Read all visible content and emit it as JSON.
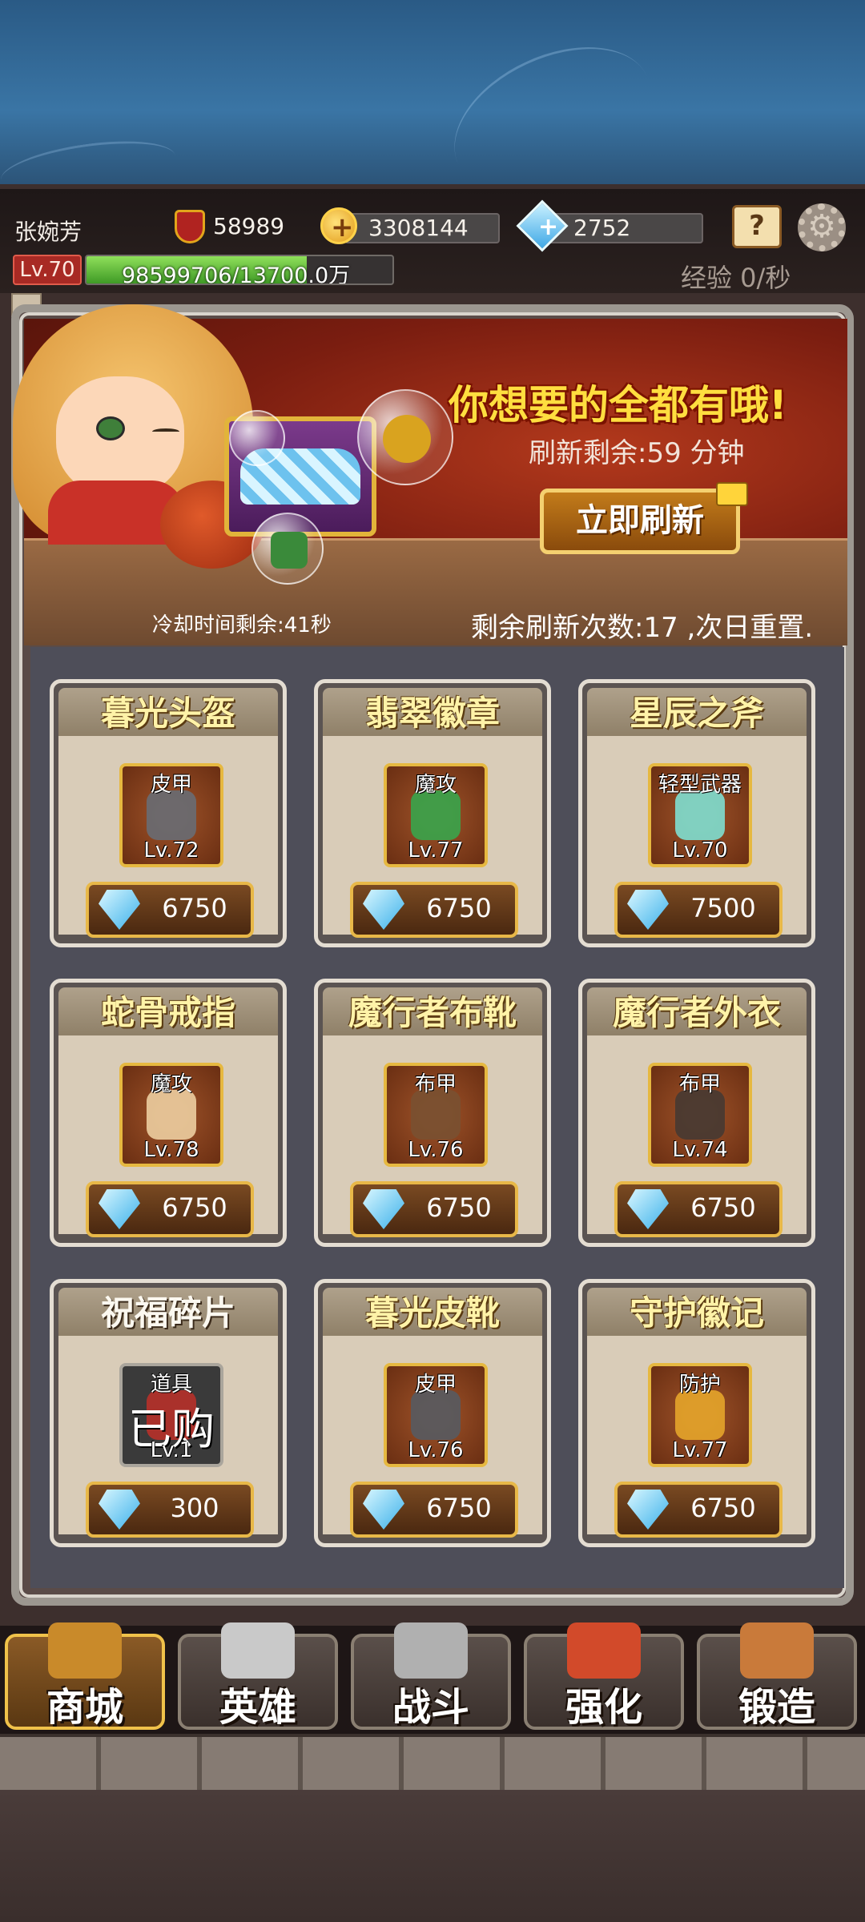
{
  "player": {
    "name": "张婉芳",
    "power": "58989",
    "gold": "3308144",
    "diamonds": "2752",
    "level": "Lv.70",
    "exp_text": "98599706/13700.0万",
    "exp_progress": 0.72,
    "exp_rate": "经验 0/秒"
  },
  "icons": {
    "power": "sword-shield-icon",
    "gold": "gold-coin-plus-icon",
    "diamond": "diamond-plus-icon",
    "help": "help-book-icon",
    "settings": "gear-icon",
    "price": "diamond-icon"
  },
  "banner": {
    "headline": "你想要的全都有哦!",
    "refresh_remaining": "刷新剩余:59 分钟",
    "refresh_button": "立即刷新",
    "cooldown": "冷却时间剩余:41秒",
    "refresh_count": "剩余刷新次数:17 ,次日重置."
  },
  "shop": {
    "items": [
      {
        "name": "暮光头盔",
        "type": "皮甲",
        "level": "Lv.72",
        "price": "6750",
        "bought": false,
        "color": "#6a6a70"
      },
      {
        "name": "翡翠徽章",
        "type": "魔攻",
        "level": "Lv.77",
        "price": "6750",
        "bought": false,
        "color": "#3da04a"
      },
      {
        "name": "星辰之斧",
        "type": "轻型武器",
        "level": "Lv.70",
        "price": "7500",
        "bought": false,
        "color": "#7fd7c8"
      },
      {
        "name": "蛇骨戒指",
        "type": "魔攻",
        "level": "Lv.78",
        "price": "6750",
        "bought": false,
        "color": "#e8c79a"
      },
      {
        "name": "魔行者布靴",
        "type": "布甲",
        "level": "Lv.76",
        "price": "6750",
        "bought": false,
        "color": "#7a5030"
      },
      {
        "name": "魔行者外衣",
        "type": "布甲",
        "level": "Lv.74",
        "price": "6750",
        "bought": false,
        "color": "#4a3a32"
      },
      {
        "name": "祝福碎片",
        "type": "道具",
        "level": "Lv.1",
        "price": "300",
        "bought": true,
        "sold_label": "已购",
        "color": "#b0302a"
      },
      {
        "name": "暮光皮靴",
        "type": "皮甲",
        "level": "Lv.76",
        "price": "6750",
        "bought": false,
        "color": "#5a5a5e"
      },
      {
        "name": "守护徽记",
        "type": "防护",
        "level": "Lv.77",
        "price": "6750",
        "bought": false,
        "color": "#e0a02a"
      }
    ]
  },
  "nav": {
    "tabs": [
      {
        "label": "商城",
        "active": true,
        "icon": "treasure-chest-icon"
      },
      {
        "label": "英雄",
        "active": false,
        "icon": "helmet-icon"
      },
      {
        "label": "战斗",
        "active": false,
        "icon": "crossed-swords-icon"
      },
      {
        "label": "强化",
        "active": false,
        "icon": "hammer-icon"
      },
      {
        "label": "锻造",
        "active": false,
        "icon": "anvil-icon"
      }
    ]
  },
  "colors": {
    "accent_gold": "#ffde3f",
    "exp_green": "#6cc83c",
    "level_red": "#a82a24"
  }
}
